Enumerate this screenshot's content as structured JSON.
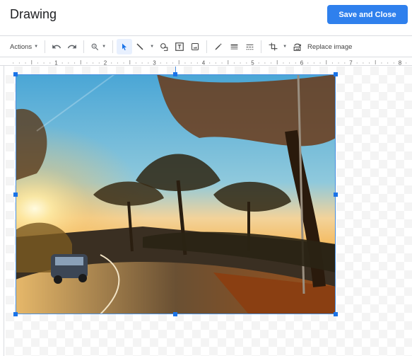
{
  "header": {
    "title": "Drawing",
    "save_button": "Save and Close",
    "accent_color": "#2f80ed"
  },
  "toolbar": {
    "actions_label": "Actions",
    "items": [
      {
        "name": "undo-icon"
      },
      {
        "name": "redo-icon"
      },
      {
        "name": "zoom-icon"
      },
      {
        "name": "select-icon",
        "active": true
      },
      {
        "name": "line-icon"
      },
      {
        "name": "shape-icon"
      },
      {
        "name": "text-box-icon"
      },
      {
        "name": "image-icon"
      },
      {
        "name": "border-color-icon"
      },
      {
        "name": "border-weight-icon"
      },
      {
        "name": "border-dash-icon"
      },
      {
        "name": "crop-icon"
      },
      {
        "name": "replace-image-icon"
      }
    ],
    "replace_image_label": "Replace image"
  },
  "ruler": {
    "labels": [
      "1",
      "2",
      "3",
      "4",
      "5",
      "6",
      "7",
      "8"
    ]
  },
  "canvas": {
    "selected_object": "image",
    "image_description": "Sunset over coastal road lined with umbrella pine trees, car on curved road"
  }
}
